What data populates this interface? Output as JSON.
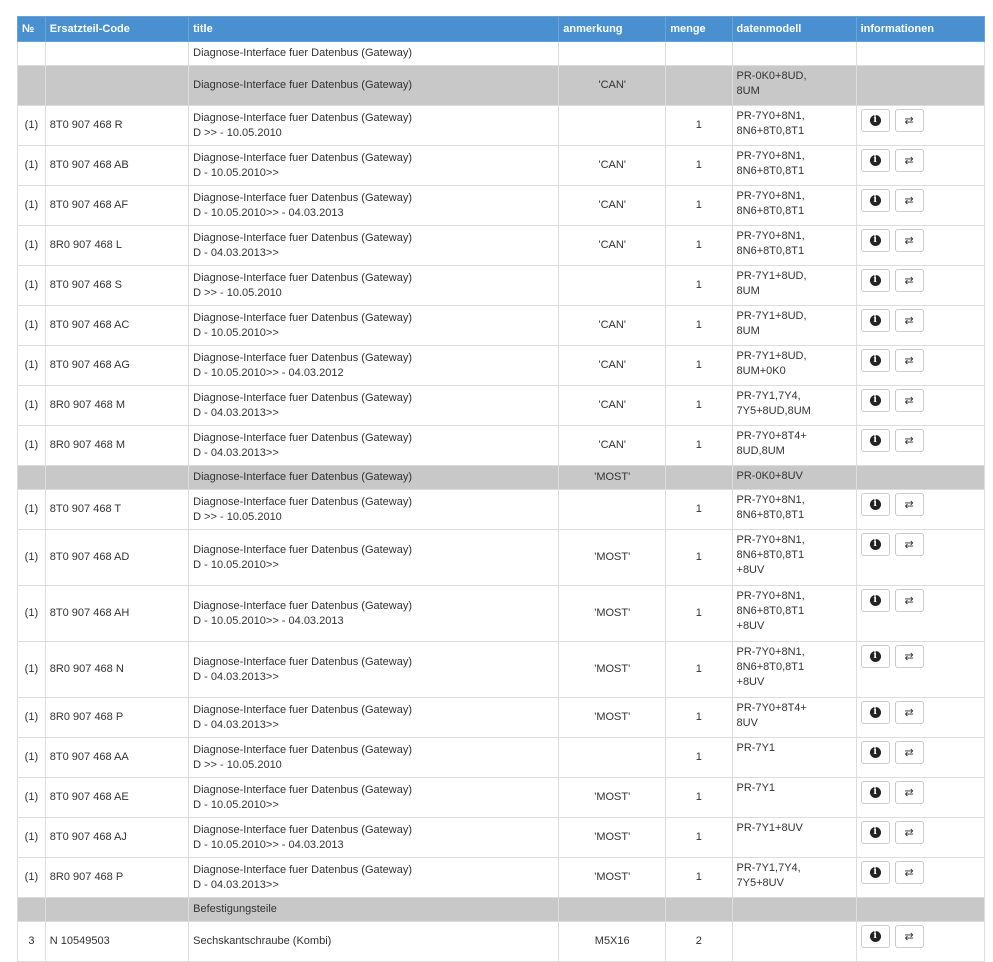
{
  "headers": {
    "no": "№",
    "code": "Ersatzteil-Code",
    "title": "title",
    "anmerkung": "anmerkung",
    "menge": "menge",
    "datenmodell": "datenmodell",
    "informationen": "informationen"
  },
  "rows": [
    {
      "kind": "first",
      "no": "",
      "code": "",
      "title": "Diagnose-Interface fuer Datenbus (Gateway)",
      "title2": "",
      "anm": "",
      "menge": "",
      "dm": "",
      "buttons": false
    },
    {
      "kind": "group",
      "no": "",
      "code": "",
      "title": "Diagnose-Interface fuer Datenbus (Gateway)",
      "title2": "",
      "anm": "'CAN'",
      "menge": "",
      "dm": "PR-0K0+8UD,\n8UM",
      "buttons": false
    },
    {
      "kind": "item",
      "no": "(1)",
      "code": "8T0 907 468 R",
      "title": "Diagnose-Interface fuer Datenbus (Gateway)",
      "title2": "D >> - 10.05.2010",
      "anm": "",
      "menge": "1",
      "dm": "PR-7Y0+8N1,\n8N6+8T0,8T1",
      "buttons": true
    },
    {
      "kind": "item",
      "no": "(1)",
      "code": "8T0 907 468 AB",
      "title": "Diagnose-Interface fuer Datenbus (Gateway)",
      "title2": "D - 10.05.2010>>",
      "anm": "'CAN'",
      "menge": "1",
      "dm": "PR-7Y0+8N1,\n8N6+8T0,8T1",
      "buttons": true
    },
    {
      "kind": "item",
      "no": "(1)",
      "code": "8T0 907 468 AF",
      "title": "Diagnose-Interface fuer Datenbus (Gateway)",
      "title2": "D - 10.05.2010>> - 04.03.2013",
      "anm": "'CAN'",
      "menge": "1",
      "dm": "PR-7Y0+8N1,\n8N6+8T0,8T1",
      "buttons": true
    },
    {
      "kind": "item",
      "no": "(1)",
      "code": "8R0 907 468 L",
      "title": "Diagnose-Interface fuer Datenbus (Gateway)",
      "title2": "D - 04.03.2013>>",
      "anm": "'CAN'",
      "menge": "1",
      "dm": "PR-7Y0+8N1,\n8N6+8T0,8T1",
      "buttons": true
    },
    {
      "kind": "item",
      "no": "(1)",
      "code": "8T0 907 468 S",
      "title": "Diagnose-Interface fuer Datenbus (Gateway)",
      "title2": "D >> - 10.05.2010",
      "anm": "",
      "menge": "1",
      "dm": "PR-7Y1+8UD,\n8UM",
      "buttons": true
    },
    {
      "kind": "item",
      "no": "(1)",
      "code": "8T0 907 468 AC",
      "title": "Diagnose-Interface fuer Datenbus (Gateway)",
      "title2": "D - 10.05.2010>>",
      "anm": "'CAN'",
      "menge": "1",
      "dm": "PR-7Y1+8UD,\n8UM",
      "buttons": true
    },
    {
      "kind": "item",
      "no": "(1)",
      "code": "8T0 907 468 AG",
      "title": "Diagnose-Interface fuer Datenbus (Gateway)",
      "title2": "D - 10.05.2010>> - 04.03.2012",
      "anm": "'CAN'",
      "menge": "1",
      "dm": "PR-7Y1+8UD,\n8UM+0K0",
      "buttons": true
    },
    {
      "kind": "item",
      "no": "(1)",
      "code": "8R0 907 468 M",
      "title": "Diagnose-Interface fuer Datenbus (Gateway)",
      "title2": "D - 04.03.2013>>",
      "anm": "'CAN'",
      "menge": "1",
      "dm": "PR-7Y1,7Y4,\n7Y5+8UD,8UM",
      "buttons": true
    },
    {
      "kind": "item",
      "no": "(1)",
      "code": "8R0 907 468 M",
      "title": "Diagnose-Interface fuer Datenbus (Gateway)",
      "title2": "D - 04.03.2013>>",
      "anm": "'CAN'",
      "menge": "1",
      "dm": "PR-7Y0+8T4+\n8UD,8UM",
      "buttons": true
    },
    {
      "kind": "group-short",
      "no": "",
      "code": "",
      "title": "Diagnose-Interface fuer Datenbus (Gateway)",
      "title2": "",
      "anm": "'MOST'",
      "menge": "",
      "dm": "PR-0K0+8UV",
      "buttons": false
    },
    {
      "kind": "item",
      "no": "(1)",
      "code": "8T0 907 468 T",
      "title": "Diagnose-Interface fuer Datenbus (Gateway)",
      "title2": "D >> - 10.05.2010",
      "anm": "",
      "menge": "1",
      "dm": "PR-7Y0+8N1,\n8N6+8T0,8T1",
      "buttons": true
    },
    {
      "kind": "item-tall",
      "no": "(1)",
      "code": "8T0 907 468 AD",
      "title": "Diagnose-Interface fuer Datenbus (Gateway)",
      "title2": "D - 10.05.2010>>",
      "anm": "'MOST'",
      "menge": "1",
      "dm": "PR-7Y0+8N1,\n8N6+8T0,8T1\n+8UV",
      "buttons": true
    },
    {
      "kind": "item-tall",
      "no": "(1)",
      "code": "8T0 907 468 AH",
      "title": "Diagnose-Interface fuer Datenbus (Gateway)",
      "title2": "D - 10.05.2010>> - 04.03.2013",
      "anm": "'MOST'",
      "menge": "1",
      "dm": "PR-7Y0+8N1,\n8N6+8T0,8T1\n+8UV",
      "buttons": true
    },
    {
      "kind": "item-tall",
      "no": "(1)",
      "code": "8R0 907 468 N",
      "title": "Diagnose-Interface fuer Datenbus (Gateway)",
      "title2": "D - 04.03.2013>>",
      "anm": "'MOST'",
      "menge": "1",
      "dm": "PR-7Y0+8N1,\n8N6+8T0,8T1\n+8UV",
      "buttons": true
    },
    {
      "kind": "item",
      "no": "(1)",
      "code": "8R0 907 468 P",
      "title": "Diagnose-Interface fuer Datenbus (Gateway)",
      "title2": "D - 04.03.2013>>",
      "anm": "'MOST'",
      "menge": "1",
      "dm": "PR-7Y0+8T4+\n8UV",
      "buttons": true
    },
    {
      "kind": "item",
      "no": "(1)",
      "code": "8T0 907 468 AA",
      "title": "Diagnose-Interface fuer Datenbus (Gateway)",
      "title2": "D >> - 10.05.2010",
      "anm": "",
      "menge": "1",
      "dm": "PR-7Y1",
      "buttons": true
    },
    {
      "kind": "item",
      "no": "(1)",
      "code": "8T0 907 468 AE",
      "title": "Diagnose-Interface fuer Datenbus (Gateway)",
      "title2": "D - 10.05.2010>>",
      "anm": "'MOST'",
      "menge": "1",
      "dm": "PR-7Y1",
      "buttons": true
    },
    {
      "kind": "item",
      "no": "(1)",
      "code": "8T0 907 468 AJ",
      "title": "Diagnose-Interface fuer Datenbus (Gateway)",
      "title2": "D - 10.05.2010>> - 04.03.2013",
      "anm": "'MOST'",
      "menge": "1",
      "dm": "PR-7Y1+8UV",
      "buttons": true
    },
    {
      "kind": "item",
      "no": "(1)",
      "code": "8R0 907 468 P",
      "title": "Diagnose-Interface fuer Datenbus (Gateway)",
      "title2": "D - 04.03.2013>>",
      "anm": "'MOST'",
      "menge": "1",
      "dm": "PR-7Y1,7Y4,\n7Y5+8UV",
      "buttons": true
    },
    {
      "kind": "group-short",
      "no": "",
      "code": "",
      "title": "Befestigungsteile",
      "title2": "",
      "anm": "",
      "menge": "",
      "dm": "",
      "buttons": false
    },
    {
      "kind": "item",
      "no": "3",
      "code": "N  10549503",
      "title": "Sechskantschraube (Kombi)",
      "title2": "",
      "anm": "M5X16",
      "menge": "2",
      "dm": "",
      "buttons": true
    }
  ],
  "icons": {
    "info": "info-icon",
    "swap": "swap-arrows-icon"
  },
  "glyphs": {
    "info": "i",
    "swap": "⇄"
  },
  "colors": {
    "header_bg": "#4a90d0",
    "group_bg": "#c8c8c8"
  }
}
